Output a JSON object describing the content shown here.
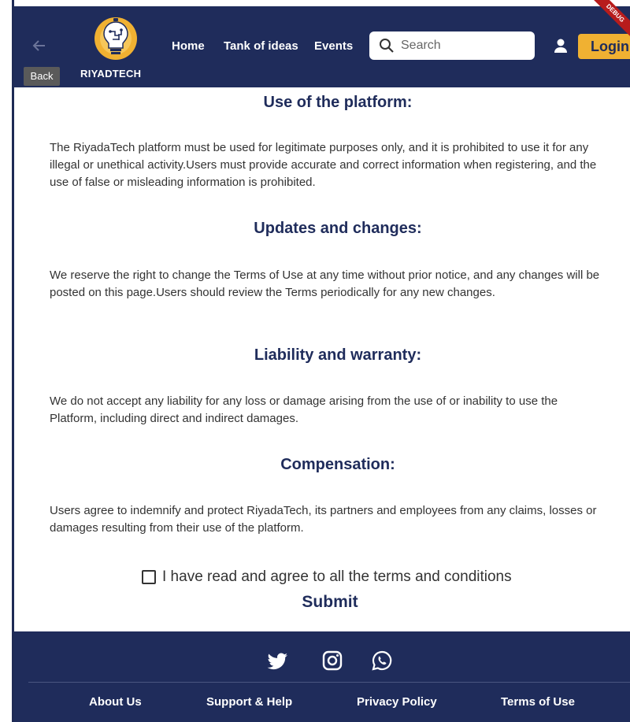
{
  "header": {
    "back_tooltip": "Back",
    "brand": "RIYADTECH",
    "nav": {
      "home": "Home",
      "tank": "Tank of ideas",
      "events": "Events"
    },
    "search_placeholder": "Search",
    "login": "Login",
    "debug_label": "DEBUG"
  },
  "sections": [
    {
      "title": "Use of the platform:",
      "body": "The RiyadaTech platform must be used for legitimate purposes only, and it is prohibited to use it for any illegal or unethical activity.Users must provide accurate and correct information when registering, and the use of false or misleading information is prohibited."
    },
    {
      "title": "Updates and changes:",
      "body": "We reserve the right to change the Terms of Use at any time without prior notice, and any changes will be posted on this page.Users should review the Terms periodically for any new changes."
    },
    {
      "title": "Liability and warranty:",
      "body": "We do not accept any liability for any loss or damage arising from the use of or inability to use the Platform, including direct and indirect damages."
    },
    {
      "title": "Compensation:",
      "body": "Users agree to indemnify and protect RiyadaTech, its partners and employees from any claims, losses or damages resulting from their use of the platform."
    }
  ],
  "agreement": {
    "label": "I have read and agree to all the terms and conditions",
    "checked": false
  },
  "submit_label": "Submit",
  "footer": {
    "social": [
      "twitter-icon",
      "instagram-icon",
      "whatsapp-icon"
    ],
    "links": {
      "about": "About Us",
      "support": "Support & Help",
      "privacy": "Privacy Policy",
      "terms": "Terms of Use"
    }
  },
  "colors": {
    "navy": "#1f2c5b",
    "accent": "#f0b132",
    "debug": "#b71c1c"
  }
}
